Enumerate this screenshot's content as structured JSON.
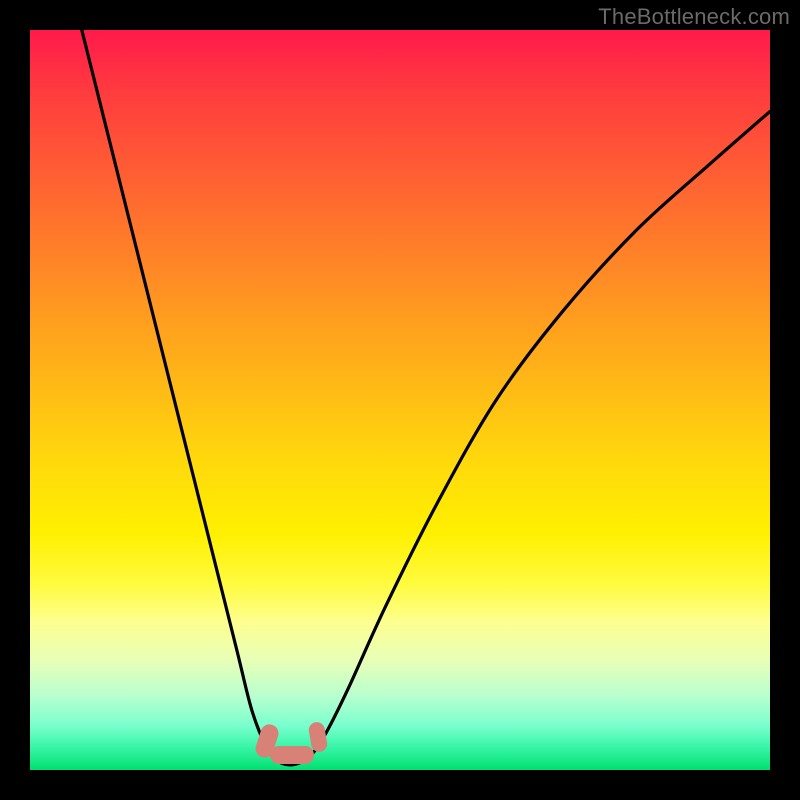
{
  "watermark": "TheBottleneck.com",
  "chart_data": {
    "type": "line",
    "title": "",
    "xlabel": "",
    "ylabel": "",
    "xlim": [
      0,
      100
    ],
    "ylim": [
      0,
      100
    ],
    "series": [
      {
        "name": "bottleneck-curve",
        "x": [
          7,
          10,
          13,
          16,
          19,
          22,
          25,
          28,
          30,
          32,
          33.5,
          35,
          36.5,
          38,
          40,
          43,
          48,
          55,
          63,
          72,
          82,
          92,
          100
        ],
        "values": [
          100,
          88,
          76,
          64,
          52,
          40,
          28,
          16,
          8,
          3,
          1.2,
          0.7,
          1.0,
          2.0,
          5,
          11,
          22,
          36,
          50,
          62,
          73,
          82,
          89
        ]
      }
    ],
    "annotations": [
      {
        "name": "min-marker-left",
        "x": 32.5,
        "y": 2.0
      },
      {
        "name": "min-marker-right",
        "x": 37.5,
        "y": 2.0
      },
      {
        "name": "min-marker-base",
        "x": 35.0,
        "y": 0.8
      }
    ],
    "gradient_stops": [
      {
        "pct": 0,
        "color": "#ff1a4b"
      },
      {
        "pct": 50,
        "color": "#ffd80c"
      },
      {
        "pct": 80,
        "color": "#fdff90"
      },
      {
        "pct": 100,
        "color": "#00e070"
      }
    ]
  }
}
